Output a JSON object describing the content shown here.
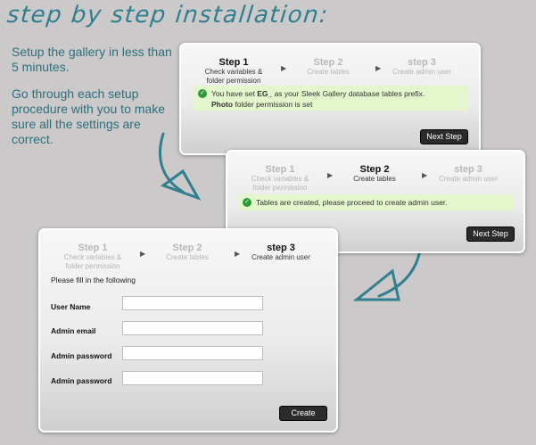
{
  "headline": "step by step installation:",
  "intro": {
    "line1": "Setup the gallery in less than 5 minutes.",
    "line2": "Go through each setup procedure with you to make sure all the settings are correct."
  },
  "steps": [
    {
      "title": "Step 1",
      "sub": "Check variables &\nfolder permission"
    },
    {
      "title": "Step 2",
      "sub": "Create tables"
    },
    {
      "title": "step 3",
      "sub": "Create admin user"
    }
  ],
  "panel1": {
    "msg_prefix": "You have set ",
    "msg_prefix_bold": "EG_",
    "msg_middle": " as your Sleek Gallery database tables prefix.",
    "msg_bold2": "Photo",
    "msg_suffix": " folder permission is set",
    "button": "Next Step"
  },
  "panel2": {
    "msg": "Tables are created, please proceed to create admin user.",
    "button": "Next Step"
  },
  "panel3": {
    "intro": "Please fill in the following",
    "fields": [
      {
        "label": "User Name",
        "value": ""
      },
      {
        "label": "Admin email",
        "value": ""
      },
      {
        "label": "Admin password",
        "value": ""
      },
      {
        "label": "Admin password",
        "value": ""
      }
    ],
    "button": "Create"
  },
  "colors": {
    "accent": "#2f7f8f",
    "success_bg": "#e4f6cc",
    "check": "#2f9a3a",
    "button_bg": "#2b2b2b"
  }
}
